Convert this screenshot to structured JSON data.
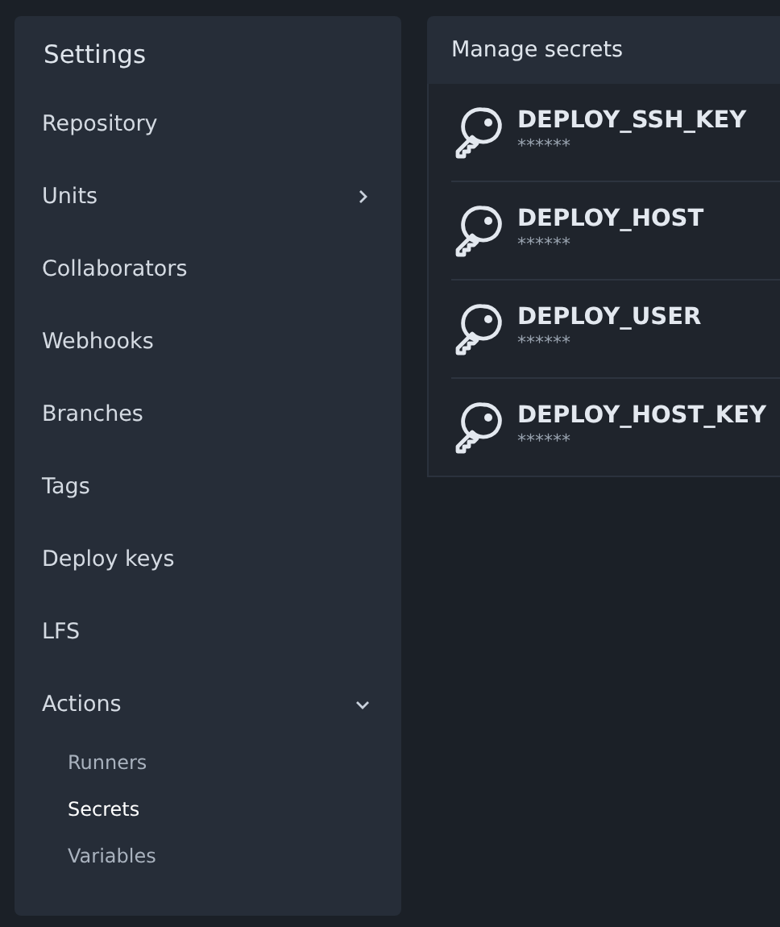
{
  "sidebar": {
    "title": "Settings",
    "items": [
      {
        "label": "Repository",
        "selected": false
      },
      {
        "label": "Units",
        "selected": false,
        "expanded": false
      },
      {
        "label": "Collaborators",
        "selected": false
      },
      {
        "label": "Webhooks",
        "selected": false
      },
      {
        "label": "Branches",
        "selected": false
      },
      {
        "label": "Tags",
        "selected": false
      },
      {
        "label": "Deploy keys",
        "selected": false
      },
      {
        "label": "LFS",
        "selected": false
      },
      {
        "label": "Actions",
        "selected": false,
        "expanded": true,
        "children": [
          {
            "label": "Runners",
            "selected": false
          },
          {
            "label": "Secrets",
            "selected": true
          },
          {
            "label": "Variables",
            "selected": false
          }
        ]
      }
    ]
  },
  "secrets": {
    "title": "Manage secrets",
    "items": [
      {
        "name": "DEPLOY_SSH_KEY",
        "value": "******"
      },
      {
        "name": "DEPLOY_HOST",
        "value": "******"
      },
      {
        "name": "DEPLOY_USER",
        "value": "******"
      },
      {
        "name": "DEPLOY_HOST_KEY",
        "value": "******"
      }
    ]
  }
}
